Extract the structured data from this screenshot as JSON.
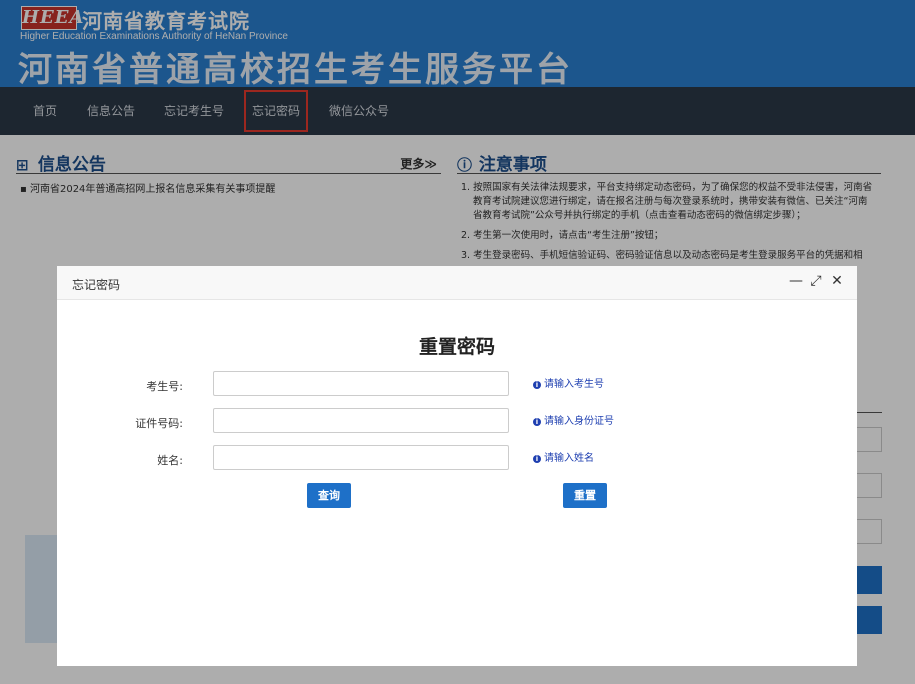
{
  "header": {
    "logo_text": "HEEA",
    "org_name_cn": "河南省教育考试院",
    "org_name_en": "Higher Education Examinations Authority of HeNan Province",
    "site_title": "河南省普通高校招生考生服务平台"
  },
  "nav": {
    "items": [
      {
        "label": "首页"
      },
      {
        "label": "信息公告"
      },
      {
        "label": "忘记考生号"
      },
      {
        "label": "忘记密码",
        "active": true
      },
      {
        "label": "微信公众号"
      }
    ]
  },
  "notice_section": {
    "title": "信息公告",
    "more_label": "更多≫",
    "items": [
      "河南省2024年普通高招网上报名信息采集有关事项提醒"
    ]
  },
  "attention_section": {
    "title": "注意事项",
    "items": [
      "1. 按照国家有关法律法规要求，平台支持绑定动态密码，为了确保您的权益不受非法侵害，河南省教育考试院建议您进行绑定，请在报名注册与每次登录系统时，携带安装有微信、已关注“河南省教育考试院”公众号并执行绑定的手机（点击查看动态密码的微信绑定步骤）；",
      "2. 考生第一次使用时，请点击“考生注册”按钮；",
      "3. 考生登录密码、手机短信验证码、密码验证信息以及动态密码是考生登录服务平台的凭据和相"
    ]
  },
  "dialog": {
    "title": "忘记密码",
    "heading": "重置密码",
    "fields": [
      {
        "label": "考生号:",
        "value": "",
        "hint": "请输入考生号"
      },
      {
        "label": "证件号码:",
        "value": "",
        "hint": "请输入身份证号"
      },
      {
        "label": "姓名:",
        "value": "",
        "hint": "请输入姓名"
      }
    ],
    "query_button": "查询",
    "reset_button": "重置",
    "controls": {
      "minimize": "—",
      "maximize": "⤢",
      "close": "✕"
    }
  },
  "colors": {
    "header_blue": "#2a7fd0",
    "nav_dark": "#2b3848",
    "button_blue": "#1e70c8",
    "hint_blue": "#1e3fb0",
    "active_outline": "#e63a2e"
  }
}
